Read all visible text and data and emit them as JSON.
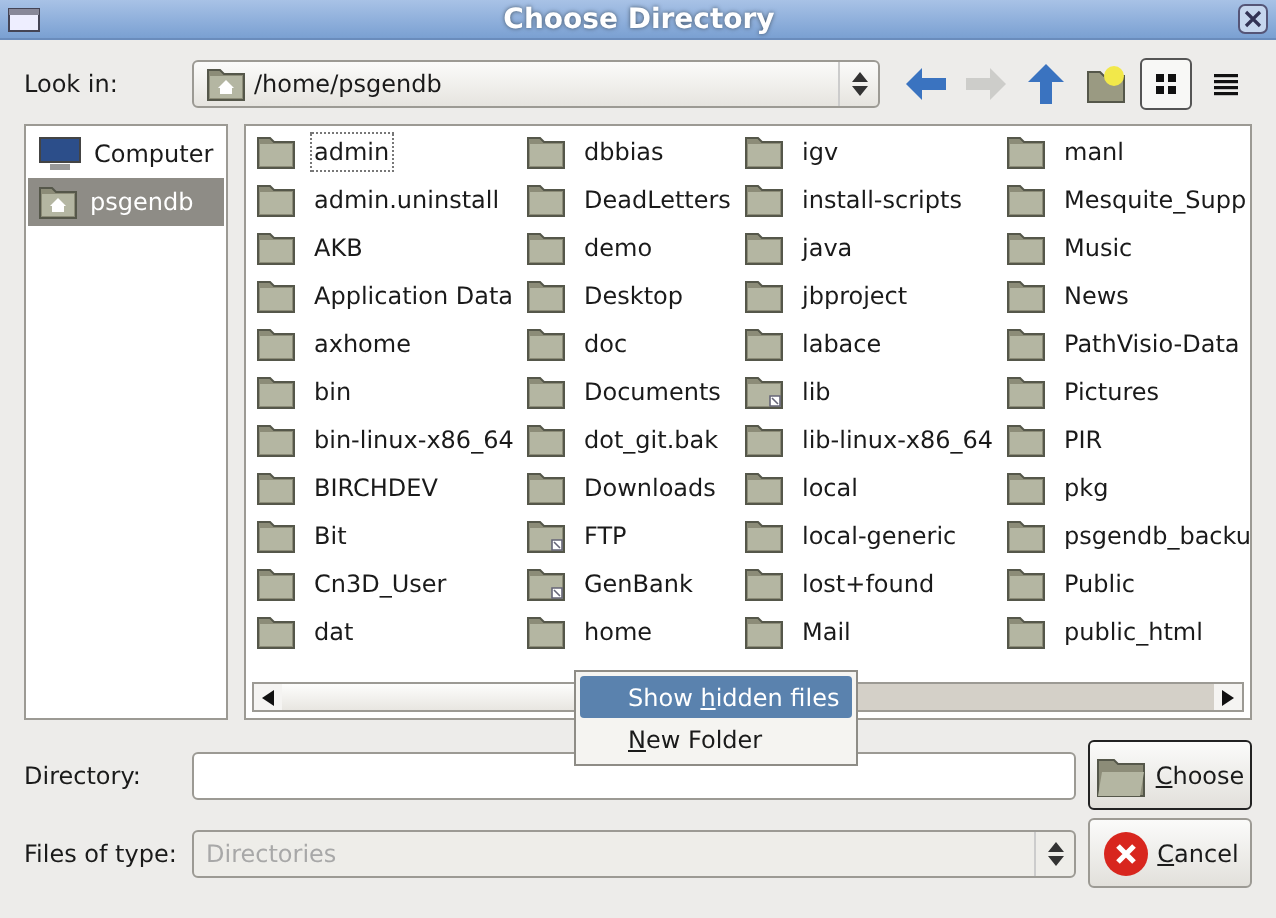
{
  "window": {
    "title": "Choose Directory"
  },
  "look_in": {
    "label": "Look in:",
    "path": "/home/psgendb"
  },
  "toolbar": [
    {
      "kind": "back",
      "disabled": false
    },
    {
      "kind": "forward",
      "disabled": true
    },
    {
      "kind": "up",
      "disabled": false
    },
    {
      "kind": "new-folder",
      "disabled": false
    },
    {
      "kind": "icon-view",
      "selected": true
    },
    {
      "kind": "list-view",
      "selected": false
    }
  ],
  "sidebar": {
    "items": [
      {
        "kind": "computer",
        "label": "Computer",
        "selected": false
      },
      {
        "kind": "home",
        "label": "psgendb",
        "selected": true
      }
    ]
  },
  "files": [
    [
      {
        "name": "admin",
        "kind": "folder",
        "focused": true
      },
      {
        "name": "admin.uninstall",
        "kind": "folder",
        "focused": false
      },
      {
        "name": "AKB",
        "kind": "folder",
        "focused": false
      },
      {
        "name": "Application Data",
        "kind": "folder",
        "focused": false
      },
      {
        "name": "axhome",
        "kind": "folder",
        "focused": false
      },
      {
        "name": "bin",
        "kind": "folder",
        "focused": false
      },
      {
        "name": "bin-linux-x86_64",
        "kind": "folder",
        "focused": false
      },
      {
        "name": "BIRCHDEV",
        "kind": "folder",
        "focused": false
      },
      {
        "name": "Bit",
        "kind": "folder",
        "focused": false
      },
      {
        "name": "Cn3D_User",
        "kind": "folder",
        "focused": false
      },
      {
        "name": "dat",
        "kind": "folder",
        "focused": false
      }
    ],
    [
      {
        "name": "dbbias",
        "kind": "folder",
        "focused": false
      },
      {
        "name": "DeadLetters",
        "kind": "folder",
        "focused": false
      },
      {
        "name": "demo",
        "kind": "folder",
        "focused": false
      },
      {
        "name": "Desktop",
        "kind": "folder",
        "focused": false
      },
      {
        "name": "doc",
        "kind": "folder",
        "focused": false
      },
      {
        "name": "Documents",
        "kind": "folder",
        "focused": false
      },
      {
        "name": "dot_git.bak",
        "kind": "folder",
        "focused": false
      },
      {
        "name": "Downloads",
        "kind": "folder",
        "focused": false
      },
      {
        "name": "FTP",
        "kind": "link",
        "focused": false
      },
      {
        "name": "GenBank",
        "kind": "link",
        "focused": false
      },
      {
        "name": "home",
        "kind": "folder",
        "focused": false
      }
    ],
    [
      {
        "name": "igv",
        "kind": "folder",
        "focused": false
      },
      {
        "name": "install-scripts",
        "kind": "folder",
        "focused": false
      },
      {
        "name": "java",
        "kind": "folder",
        "focused": false
      },
      {
        "name": "jbproject",
        "kind": "folder",
        "focused": false
      },
      {
        "name": "labace",
        "kind": "folder",
        "focused": false
      },
      {
        "name": "lib",
        "kind": "link",
        "focused": false
      },
      {
        "name": "lib-linux-x86_64",
        "kind": "folder",
        "focused": false
      },
      {
        "name": "local",
        "kind": "folder",
        "focused": false
      },
      {
        "name": "local-generic",
        "kind": "folder",
        "focused": false
      },
      {
        "name": "lost+found",
        "kind": "folder",
        "focused": false
      },
      {
        "name": "Mail",
        "kind": "folder",
        "focused": false
      }
    ],
    [
      {
        "name": "manl",
        "kind": "folder",
        "focused": false
      },
      {
        "name": "Mesquite_Supp",
        "kind": "folder",
        "focused": false
      },
      {
        "name": "Music",
        "kind": "folder",
        "focused": false
      },
      {
        "name": "News",
        "kind": "folder",
        "focused": false
      },
      {
        "name": "PathVisio-Data",
        "kind": "folder",
        "focused": false
      },
      {
        "name": "Pictures",
        "kind": "folder",
        "focused": false
      },
      {
        "name": "PIR",
        "kind": "folder",
        "focused": false
      },
      {
        "name": "pkg",
        "kind": "folder",
        "focused": false
      },
      {
        "name": "psgendb_backu",
        "kind": "folder",
        "focused": false
      },
      {
        "name": "Public",
        "kind": "folder",
        "focused": false
      },
      {
        "name": "public_html",
        "kind": "folder",
        "focused": false
      }
    ]
  ],
  "context_menu": [
    {
      "before": "Show ",
      "key": "h",
      "after": "idden files",
      "selected": true
    },
    {
      "key": "N",
      "after": "ew Folder",
      "selected": false
    }
  ],
  "directory": {
    "label": "Directory:"
  },
  "file_type": {
    "label": "Files of type:",
    "value": "Directories",
    "disabled": true
  },
  "buttons": [
    {
      "kind": "choose",
      "key": "C",
      "after": "hoose",
      "default": true
    },
    {
      "kind": "cancel",
      "key": "C",
      "after": "ancel",
      "default": false
    }
  ]
}
